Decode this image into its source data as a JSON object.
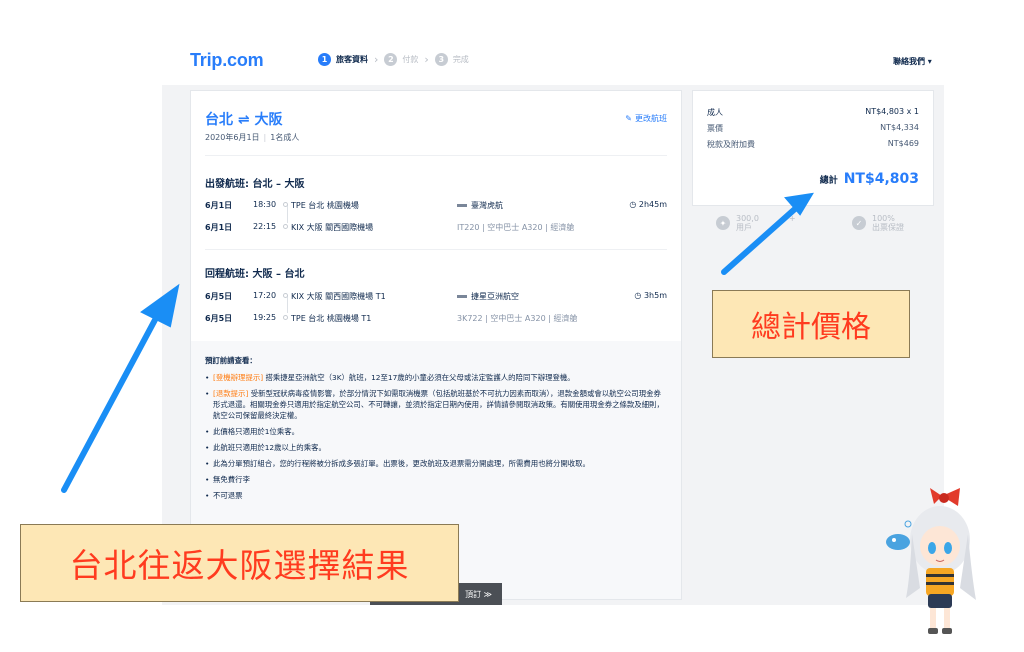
{
  "header": {
    "logo_main": "Trip",
    "logo_dot": ".com",
    "steps": [
      {
        "num": "1",
        "label": "旅客資料"
      },
      {
        "num": "2",
        "label": "付款"
      },
      {
        "num": "3",
        "label": "完成"
      }
    ],
    "contact": "聯絡我們 ▾"
  },
  "trip": {
    "title": "台北 ⇌ 大阪",
    "date": "2020年6月1日",
    "pax": "1名成人",
    "change_label": "更改航班"
  },
  "outbound": {
    "title": "出發航班: 台北 – 大阪",
    "dep": {
      "date": "6月1日",
      "time": "18:30",
      "airport": "TPE 台北 桃園機場",
      "airline": "臺灣虎航",
      "duration": "2h45m"
    },
    "arr": {
      "date": "6月1日",
      "time": "22:15",
      "airport": "KIX 大阪 關西國際機場",
      "flight": "IT220",
      "aircraft": "空中巴士 A320",
      "cabin": "經濟艙"
    }
  },
  "inbound": {
    "title": "回程航班: 大阪 – 台北",
    "dep": {
      "date": "6月5日",
      "time": "17:20",
      "airport": "KIX 大阪 關西國際機場 T1",
      "airline": "捷星亞洲航空",
      "duration": "3h5m"
    },
    "arr": {
      "date": "6月5日",
      "time": "19:25",
      "airport": "TPE 台北 桃園機場 T1",
      "flight": "3K722",
      "aircraft": "空中巴士 A320",
      "cabin": "經濟艙"
    }
  },
  "notes": {
    "title": "預訂前請查看：",
    "items": [
      {
        "tag": "[登機辦理提示]",
        "text": " 搭乘捷星亞洲航空（3K）航班，12至17歲的小童必須在父母或法定監護人的陪同下辦理登機。"
      },
      {
        "tag": "[退款提示]",
        "text": " 受新型冠狀病毒疫情影響，於部分情況下如需取消機票（包括航班基於不可抗力因素而取消），退款金額或會以航空公司現金券形式退還。相關現金券只適用於指定航空公司、不可轉讓，並須於指定日期內使用，詳情請參閱取消政策。有關使用現金券之條款及細則，航空公司保留最終決定權。"
      },
      {
        "tag": "",
        "text": "此價格只適用於1位乘客。"
      },
      {
        "tag": "",
        "text": "此航班只適用於12歲以上的乘客。"
      },
      {
        "tag": "",
        "text": "此為分單預訂組合，您的行程將被分拆成多張訂單。出票後，更改航班及退票需分開處理，所需費用也將分開收取。"
      },
      {
        "tag": "",
        "text": "無免費行李"
      },
      {
        "tag": "",
        "text": "不可退票"
      }
    ]
  },
  "price": {
    "adult_label": "成人",
    "adult_value": "NT$4,803 x 1",
    "fare_label": "票價",
    "fare_value": "NT$4,334",
    "tax_label": "稅款及附加費",
    "tax_value": "NT$469",
    "total_label": "總計",
    "total_value": "NT$4,803"
  },
  "perks": {
    "users_top": "300,0",
    "users_bottom": "用戶",
    "users_suffix": "+",
    "guarantee_top": "100%",
    "guarantee_bottom": "出票保證"
  },
  "bottom_bar": "頂訂 ≫",
  "annotations": {
    "total": "總計價格",
    "result": "台北往返大阪選擇結果"
  },
  "colors": {
    "brand": "#287dfa",
    "annotation_text": "#ff3b1f",
    "annotation_bg": "#fde7b5",
    "arrow": "#1a8ef5"
  }
}
